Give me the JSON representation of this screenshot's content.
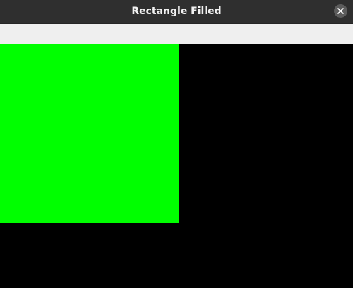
{
  "window": {
    "title": "Rectangle Filled"
  },
  "titlebar": {
    "minimize_icon": "minimize-icon",
    "close_icon": "close-icon"
  },
  "canvas": {
    "background_color": "#000000",
    "shapes": [
      {
        "type": "rectangle",
        "filled": true,
        "color": "#00ff00"
      }
    ]
  }
}
